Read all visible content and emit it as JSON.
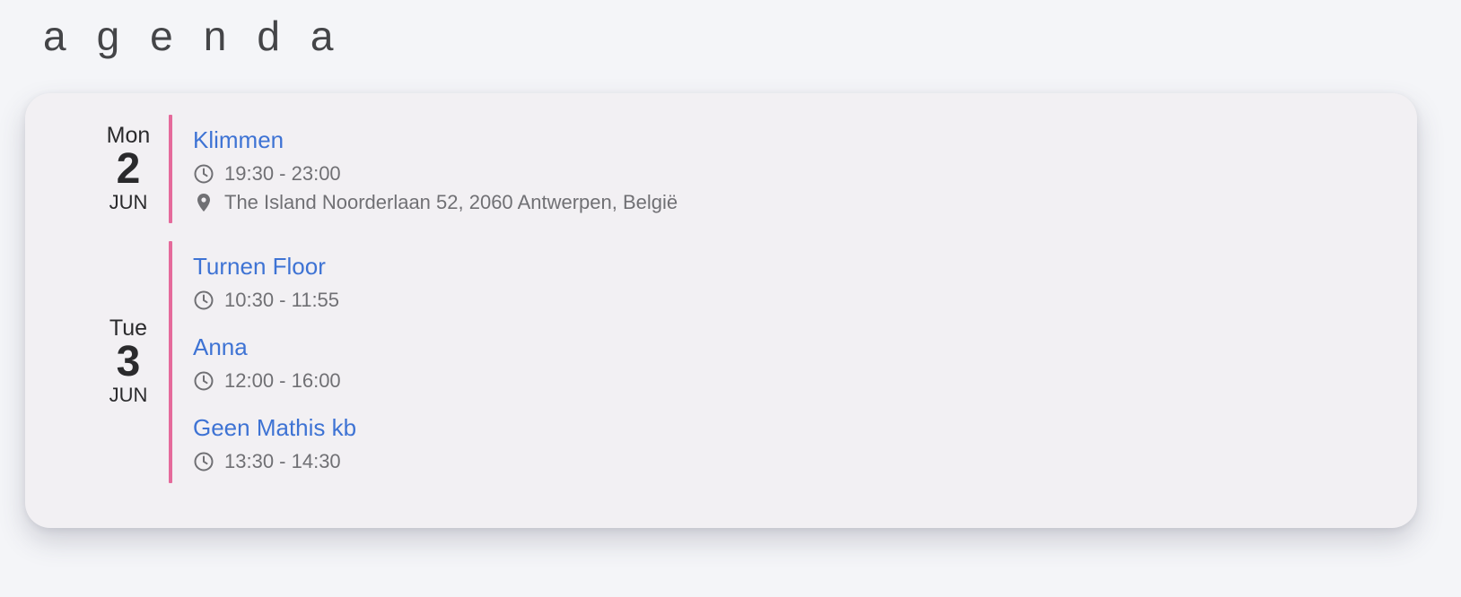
{
  "page": {
    "title": "agenda"
  },
  "colors": {
    "background": "#f4f5f8",
    "card": "#f2f0f3",
    "accent_bar": "#e56a9b",
    "event_title": "#3e73d4",
    "meta_text": "#707074"
  },
  "days": [
    {
      "dow": "Mon",
      "day": "2",
      "month": "JUN",
      "events": [
        {
          "title": "Klimmen",
          "time": "19:30 - 23:00",
          "location": "The Island Noorderlaan 52, 2060 Antwerpen, België",
          "time_icon": "clock-icon",
          "location_icon": "location-pin-icon"
        }
      ]
    },
    {
      "dow": "Tue",
      "day": "3",
      "month": "JUN",
      "events": [
        {
          "title": "Turnen Floor",
          "time": "10:30 - 11:55",
          "time_icon": "clock-icon"
        },
        {
          "title": "Anna",
          "time": "12:00 - 16:00",
          "time_icon": "clock-icon"
        },
        {
          "title": "Geen Mathis kb",
          "time": "13:30 - 14:30",
          "time_icon": "clock-icon"
        }
      ]
    }
  ]
}
